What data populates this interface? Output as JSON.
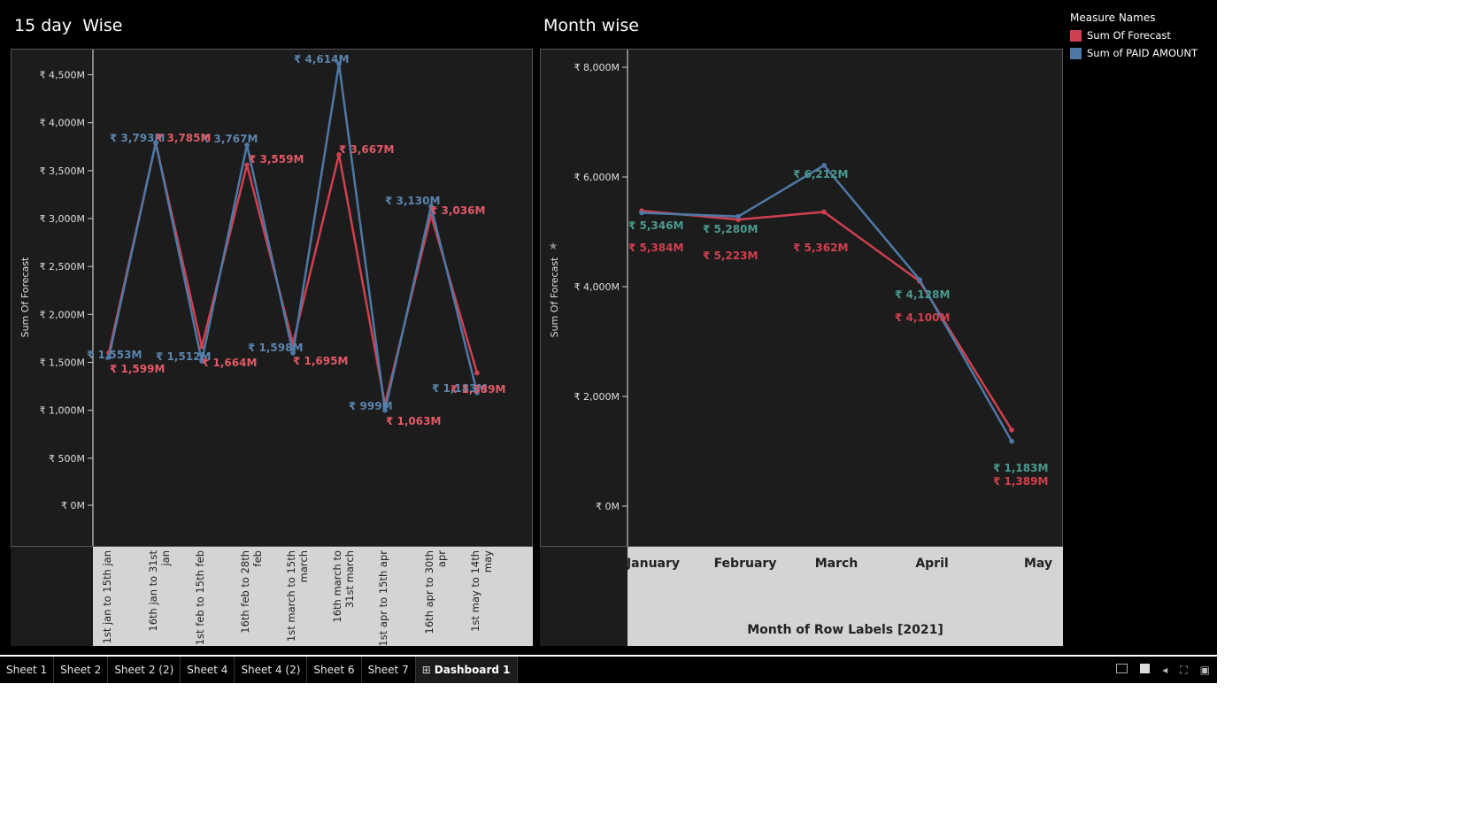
{
  "colors": {
    "forecast": "#d1404f",
    "paid": "#4e79a7",
    "paid_label_month": "#4a9a8f",
    "label_15_paid": "#5b84ad",
    "label_15_fore": "#e05a66"
  },
  "left_chart": {
    "title": "15 day  Wise",
    "y_axis_label": "Sum Of Forecast",
    "y_ticks": [
      "₹ 4,500M",
      "₹ 4,000M",
      "₹ 3,500M",
      "₹ 3,000M",
      "₹ 2,500M",
      "₹ 2,000M",
      "₹ 1,500M",
      "₹ 1,000M",
      "₹ 500M",
      "₹ 0M"
    ],
    "categories": [
      [
        "1st jan to 15th jan"
      ],
      [
        "16th jan to 31st",
        "jan"
      ],
      [
        "1st feb to 15th feb"
      ],
      [
        "16th feb to 28th",
        "feb"
      ],
      [
        "1st march to 15th",
        "march"
      ],
      [
        "16th march to",
        "31st march"
      ],
      [
        "1st apr to 15th apr"
      ],
      [
        "16th apr to 30th",
        "apr"
      ],
      [
        "1st may to 14th",
        "may"
      ]
    ]
  },
  "right_chart": {
    "title": "Month wise",
    "y_axis_label": "Sum Of Forecast",
    "y_ticks": [
      "₹ 8,000M",
      "₹ 6,000M",
      "₹ 4,000M",
      "₹ 2,000M",
      "₹ 0M"
    ],
    "x_axis_title": "Month of Row Labels [2021]",
    "categories": [
      "January",
      "February",
      "March",
      "April",
      "May"
    ]
  },
  "legend": {
    "title": "Measure Names",
    "items": [
      {
        "label": "Sum Of Forecast",
        "color": "#d1404f"
      },
      {
        "label": "Sum of PAID AMOUNT",
        "color": "#4e79a7"
      }
    ]
  },
  "tabs": [
    "Sheet 1",
    "Sheet 2",
    "Sheet 2 (2)",
    "Sheet 4",
    "Sheet 4 (2)",
    "Sheet 6",
    "Sheet 7",
    "Dashboard 1"
  ],
  "active_tab": "Dashboard 1",
  "chart_data": [
    {
      "type": "line",
      "title": "15 day  Wise",
      "ylabel": "Sum Of Forecast",
      "ylim": [
        0,
        4750
      ],
      "categories": [
        "1st jan to 15th jan",
        "16th jan to 31st jan",
        "1st feb to 15th feb",
        "16th feb to 28th feb",
        "1st march to 15th march",
        "16th march to 31st march",
        "1st apr to 15th apr",
        "16th apr to 30th apr",
        "1st may to 14th may"
      ],
      "series": [
        {
          "name": "Sum Of Forecast",
          "values": [
            1599,
            3785,
            1664,
            3559,
            1695,
            3667,
            1063,
            3036,
            1389
          ],
          "labels": [
            "₹ 1,599M",
            "₹ 3,785M",
            "₹ 1,664M",
            "₹ 3,559M",
            "₹ 1,695M",
            "₹ 3,667M",
            "₹ 1,063M",
            "₹ 3,036M",
            "₹ 1,389M"
          ]
        },
        {
          "name": "Sum of PAID AMOUNT",
          "values": [
            1553,
            3793,
            1512,
            3767,
            1598,
            4614,
            999,
            3130,
            1183
          ],
          "labels": [
            "₹ 1,553M",
            "₹ 3,793M",
            "₹ 1,512M",
            "₹ 3,767M",
            "₹ 1,598M",
            "₹ 4,614M",
            "₹ 999M",
            "₹ 3,130M",
            "₹ 1,183M"
          ]
        }
      ]
    },
    {
      "type": "line",
      "title": "Month wise",
      "xlabel": "Month of Row Labels [2021]",
      "ylabel": "Sum Of Forecast",
      "ylim": [
        0,
        8500
      ],
      "categories": [
        "January",
        "February",
        "March",
        "April",
        "May"
      ],
      "series": [
        {
          "name": "Sum Of Forecast",
          "values": [
            5384,
            5223,
            5362,
            4100,
            1389
          ],
          "labels": [
            "₹ 5,384M",
            "₹ 5,223M",
            "₹ 5,362M",
            "₹ 4,100M",
            "₹ 1,389M"
          ]
        },
        {
          "name": "Sum of PAID AMOUNT",
          "values": [
            5346,
            5280,
            6212,
            4128,
            1183
          ],
          "labels": [
            "₹ 5,346M",
            "₹ 5,280M",
            "₹ 6,212M",
            "₹ 4,128M",
            "₹ 1,183M"
          ]
        }
      ]
    }
  ]
}
